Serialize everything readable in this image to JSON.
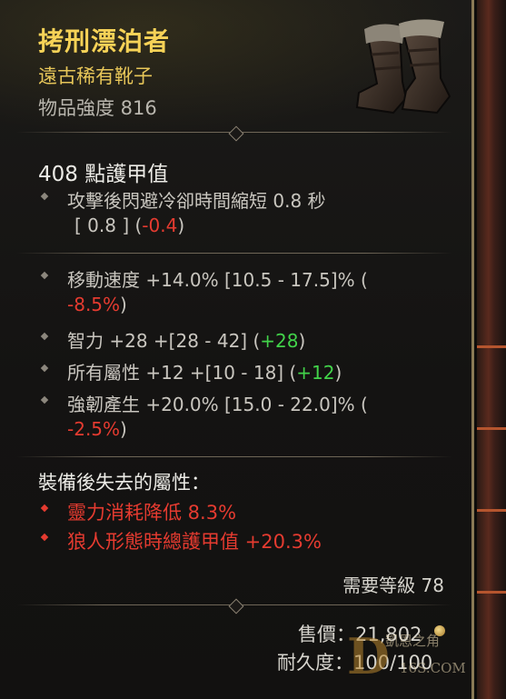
{
  "item": {
    "name": "拷刑漂泊者",
    "type": "遠古稀有靴子",
    "power": "物品強度 816",
    "armor": "408 點護甲值"
  },
  "implicit": {
    "line1": "攻擊後閃避冷卻時間縮短 0.8 秒",
    "line2_plain": "[ 0.8 ]  (",
    "line2_delta": "-0.4",
    "line2_close": ")"
  },
  "affixes": [
    {
      "text": "移動速度 +14.0% [10.5 - 17.5]% (",
      "delta": "-8.5%",
      "close": ")",
      "delta_color": "red",
      "wrap": true
    },
    {
      "text": "智力 +28 +[28 - 42] (",
      "delta": "+28",
      "close": ")",
      "delta_color": "green",
      "wrap": false
    },
    {
      "text": "所有屬性 +12 +[10 - 18] (",
      "delta": "+12",
      "close": ")",
      "delta_color": "green",
      "wrap": false
    },
    {
      "text": "強韌產生 +20.0% [15.0 - 22.0]% (",
      "delta": "-2.5%",
      "close": ")",
      "delta_color": "red",
      "wrap": true
    }
  ],
  "lost": {
    "heading": "裝備後失去的屬性：",
    "items": [
      "靈力消耗降低 8.3%",
      "狼人形態時總護甲值 +20.3%"
    ]
  },
  "footer": {
    "required_level": "需要等級 78",
    "sell_label": "售價：",
    "sell_value": "21,802",
    "durability_label": "耐久度：",
    "durability_value": "100/100"
  },
  "watermark": {
    "logo_letter": "D",
    "site_name": "凱恩之角",
    "url": "16S.COM"
  },
  "icons": [
    "boots-icon",
    "gold-coin-icon",
    "bullet-diamond-icon"
  ],
  "colors": {
    "legendary_gold": "#f6d257",
    "negative": "#e53b30",
    "positive": "#42d34a"
  }
}
